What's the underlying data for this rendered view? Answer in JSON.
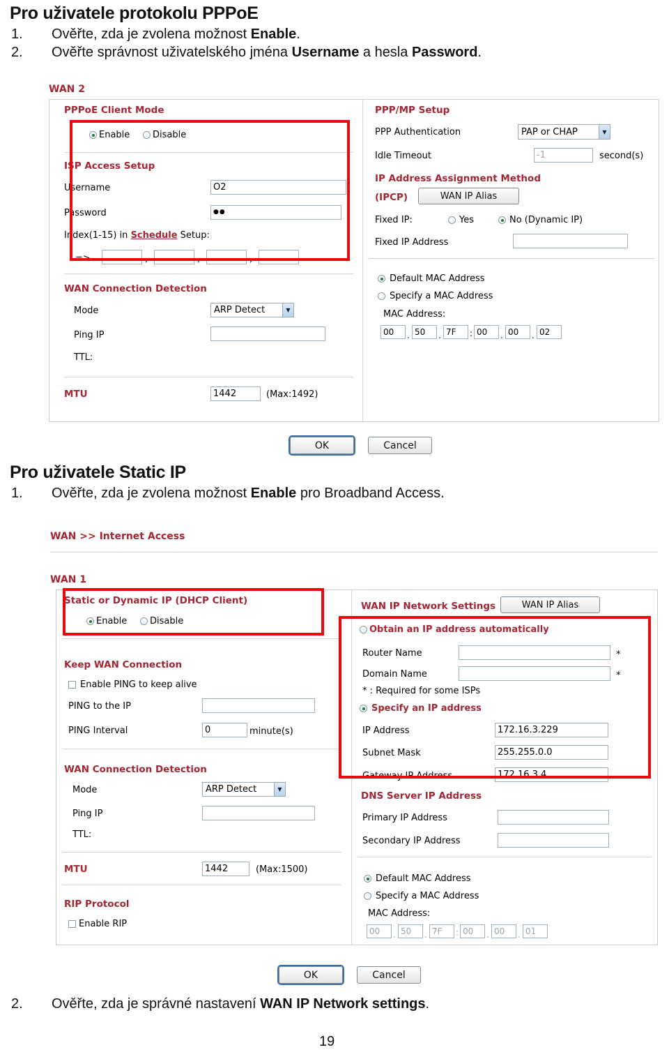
{
  "document": {
    "section1": {
      "heading": "Pro uživatele protokolu PPPoE",
      "steps": [
        {
          "num": "1.",
          "pre": "Ověřte, zda je zvolena možnost ",
          "strong": "Enable",
          "post": "."
        },
        {
          "num": "2.",
          "pre": "Ověřte správnost uživatelského jména ",
          "strong": "Username",
          "mid": " a hesla ",
          "strong2": "Password",
          "post": "."
        }
      ]
    },
    "section2": {
      "heading": "Pro uživatele Static IP",
      "steps": [
        {
          "num": "1.",
          "pre": "Ověřte, zda je zvolena možnost ",
          "strong": "Enable",
          "post": " pro Broadband Access."
        },
        {
          "num": "2.",
          "pre": "Ověřte, zda je správné nastavení ",
          "strong": "WAN IP Network settings",
          "post": "."
        }
      ]
    },
    "page_number": "19"
  },
  "screenshot1": {
    "wan_label": "WAN 2",
    "left": {
      "mode_title": "PPPoE Client Mode",
      "enable_label": "Enable",
      "disable_label": "Disable",
      "enable_selected": true,
      "isp_title": "ISP Access Setup",
      "username_label": "Username",
      "username_value": "O2",
      "password_label": "Password",
      "password_value": "●●",
      "index_pre": "Index(1-15) in ",
      "index_link": "Schedule",
      "index_post": " Setup:",
      "arrow": "=>",
      "schedule_values": [
        "",
        "",
        "",
        ""
      ],
      "comma": ",",
      "detect_title": "WAN Connection Detection",
      "mode_label": "Mode",
      "mode_value": "ARP Detect",
      "ping_ip_label": "Ping IP",
      "ping_ip_value": "",
      "ttl_label": "TTL:",
      "mtu_label": "MTU",
      "mtu_value": "1442",
      "mtu_max": "(Max:1492)"
    },
    "right": {
      "pppmp_title": "PPP/MP Setup",
      "ppp_auth_label": "PPP Authentication",
      "ppp_auth_value": "PAP or CHAP",
      "idle_label": "Idle Timeout",
      "idle_value": "-1",
      "idle_units": "second(s)",
      "ipcp_title": "IP Address Assignment Method",
      "ipcp_sub": "(IPCP)",
      "wan_ip_alias_button": "WAN IP Alias",
      "fixed_ip_label": "Fixed IP:",
      "yes_label": "Yes",
      "no_label": "No (Dynamic IP)",
      "fixed_ip_selected": "No",
      "fixed_ip_addr_label": "Fixed IP Address",
      "fixed_ip_addr_value": "",
      "default_mac_label": "Default MAC Address",
      "specify_mac_label": "Specify a MAC Address",
      "mac_selected": "default",
      "mac_address_label": "MAC Address:",
      "mac_octets": [
        "00",
        "50",
        "7F",
        "00",
        "00",
        "02"
      ]
    },
    "buttons": {
      "ok": "OK",
      "cancel": "Cancel"
    }
  },
  "screenshot2": {
    "breadcrumb": "WAN >> Internet Access",
    "wan_label": "WAN 1",
    "left": {
      "mode_title": "Static or Dynamic IP (DHCP Client)",
      "enable_label": "Enable",
      "disable_label": "Disable",
      "enable_selected": true,
      "keep_title": "Keep WAN Connection",
      "keep_ping_label": "Enable PING to keep alive",
      "keep_ping_checked": false,
      "ping_to_ip_label": "PING to the IP",
      "ping_to_ip_value": "",
      "ping_interval_label": "PING Interval",
      "ping_interval_value": "0",
      "ping_interval_units": "minute(s)",
      "detect_title": "WAN Connection Detection",
      "mode_label": "Mode",
      "mode_value": "ARP Detect",
      "ping_ip_label": "Ping IP",
      "ping_ip_value": "",
      "ttl_label": "TTL:",
      "mtu_label": "MTU",
      "mtu_value": "1442",
      "mtu_max": "(Max:1500)",
      "rip_title": "RIP Protocol",
      "rip_label": "Enable RIP",
      "rip_checked": false
    },
    "right": {
      "net_title": "WAN IP Network Settings",
      "wan_ip_alias_button": "WAN IP Alias",
      "obtain_label": "Obtain an IP address automatically",
      "router_name_label": "Router Name",
      "router_name_value": "",
      "domain_name_label": "Domain Name",
      "domain_name_value": "",
      "required_note": "* : Required for some ISPs",
      "asterisk": "*",
      "specify_label": "Specify an IP address",
      "ip_mode_selected": "specify",
      "ip_address_label": "IP Address",
      "ip_address_value": "172.16.3.229",
      "subnet_label": "Subnet Mask",
      "subnet_value": "255.255.0.0",
      "gateway_label": "Gateway IP Address",
      "gateway_value": "172.16.3.4",
      "dns_title": "DNS Server IP Address",
      "primary_label": "Primary IP Address",
      "primary_value": "",
      "secondary_label": "Secondary IP Address",
      "secondary_value": "",
      "default_mac_label": "Default MAC Address",
      "specify_mac_label": "Specify a MAC Address",
      "mac_selected": "default",
      "mac_address_label": "MAC Address:",
      "mac_octets": [
        "00",
        "50",
        "7F",
        "00",
        "00",
        "01"
      ]
    },
    "buttons": {
      "ok": "OK",
      "cancel": "Cancel"
    }
  },
  "colors": {
    "section_red": "#a32633",
    "highlight_red": "#e8090d",
    "radio_green": "#1f7a2e",
    "input_border": "#9fb0bd"
  }
}
